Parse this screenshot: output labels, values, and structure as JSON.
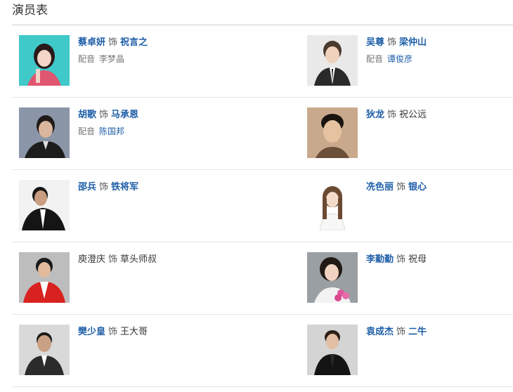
{
  "section_title": "演员表",
  "role_word": "饰",
  "dub_word": "配音",
  "colors": {
    "link": "#1e5ea8",
    "text": "#333333",
    "muted": "#777777",
    "divider": "#e6e6e6"
  },
  "rows": [
    {
      "left": {
        "actor": "蔡卓妍",
        "role": "祝言之",
        "dub": "李梦晶"
      },
      "right": {
        "actor": "吴尊",
        "role": "梁仲山",
        "dub": "谭俊彦"
      }
    },
    {
      "left": {
        "actor": "胡歌",
        "role": "马承恩",
        "dub": "陈国邦"
      },
      "right": {
        "actor": "狄龙",
        "role": "祝公远",
        "dub": ""
      }
    },
    {
      "left": {
        "actor": "邵兵",
        "role": "铁将军",
        "dub": ""
      },
      "right": {
        "actor": "冼色丽",
        "role": "银心",
        "dub": ""
      }
    },
    {
      "left": {
        "actor": "庾澄庆",
        "role": "草头师叔",
        "dub": ""
      },
      "right": {
        "actor": "李勤勤",
        "role": "祝母",
        "dub": ""
      }
    },
    {
      "left": {
        "actor": "樊少皇",
        "role": "王大哥",
        "dub": ""
      },
      "right": {
        "actor": "袁成杰",
        "role": "二牛",
        "dub": ""
      }
    }
  ]
}
